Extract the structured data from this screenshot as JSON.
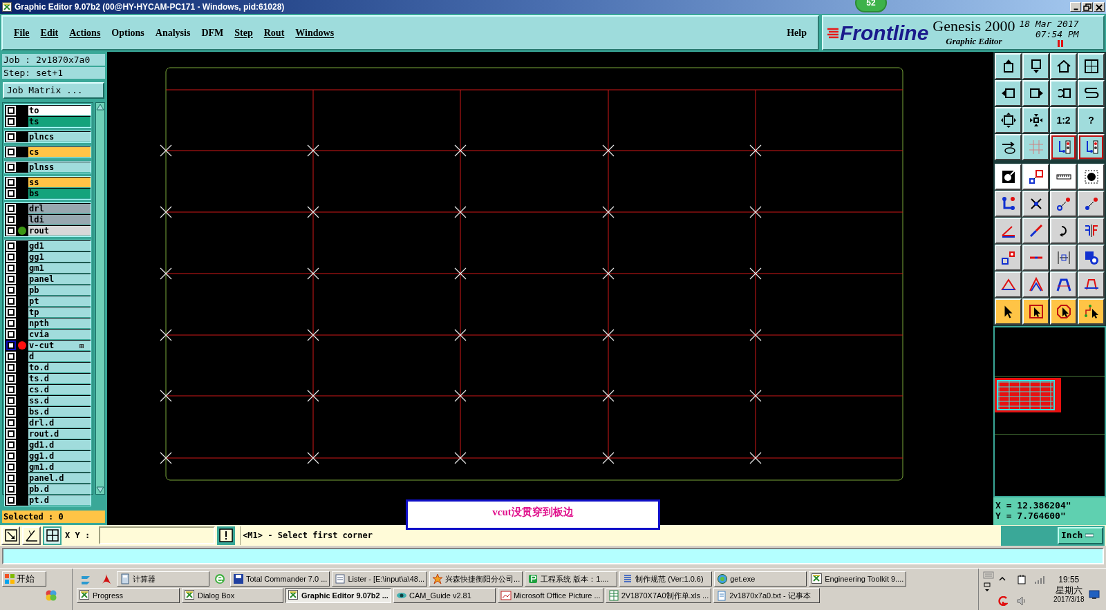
{
  "window": {
    "title": "Graphic Editor 9.07b2 (00@HY-HYCAM-PC171 - Windows, pid:61028)",
    "badge": "52"
  },
  "menu": [
    {
      "label": "File",
      "underline": true
    },
    {
      "label": "Edit",
      "underline": true
    },
    {
      "label": "Actions",
      "underline": true
    },
    {
      "label": "Options",
      "underline": false
    },
    {
      "label": "Analysis",
      "underline": false
    },
    {
      "label": "DFM",
      "underline": false
    },
    {
      "label": "Step",
      "underline": true
    },
    {
      "label": "Rout",
      "underline": true
    },
    {
      "label": "Windows",
      "underline": true
    }
  ],
  "help": "Help",
  "brand": {
    "logo": "Frontline",
    "product": "Genesis 2000",
    "subtitle": "Graphic Editor",
    "date": "18 Mar 2017",
    "time": "07:54 PM"
  },
  "job": "Job : 2v1870x7a0",
  "step": "Step: set+1",
  "job_matrix": "Job Matrix ...",
  "layer_groups": [
    [
      {
        "name": "to",
        "color": "#ffffff",
        "work_layer": false
      },
      {
        "name": "ts",
        "color": "#14a37c",
        "work_layer": false
      }
    ],
    [
      {
        "name": "plncs",
        "color": "#a0dcdc",
        "work_layer": false
      }
    ],
    [
      {
        "name": "cs",
        "color": "#ffc446",
        "work_layer": false
      }
    ],
    [
      {
        "name": "plnss",
        "color": "#a0dcdc",
        "work_layer": false
      }
    ],
    [
      {
        "name": "ss",
        "color": "#ffc446",
        "work_layer": false
      },
      {
        "name": "bs",
        "color": "#14a37c",
        "work_layer": false
      }
    ],
    [
      {
        "name": "drl",
        "color": "#98a8b0",
        "work_layer": false
      },
      {
        "name": "ldi",
        "color": "#98a8b0",
        "work_layer": false
      },
      {
        "name": "rout",
        "color": "#d8d8d8",
        "dot": {
          "color": "#3c9614"
        },
        "work_layer": false
      }
    ],
    [
      {
        "name": "gd1",
        "color": "#a0dcdc",
        "work_layer": false
      },
      {
        "name": "gg1",
        "color": "#a0dcdc",
        "work_layer": false
      },
      {
        "name": "gm1",
        "color": "#a0dcdc",
        "work_layer": false
      },
      {
        "name": "panel",
        "color": "#a0dcdc",
        "work_layer": false
      },
      {
        "name": "pb",
        "color": "#a0dcdc",
        "work_layer": false
      },
      {
        "name": "pt",
        "color": "#a0dcdc",
        "work_layer": false
      },
      {
        "name": "tp",
        "color": "#a0dcdc",
        "work_layer": false
      },
      {
        "name": "npth",
        "color": "#a0dcdc",
        "work_layer": false
      },
      {
        "name": "cvia",
        "color": "#a0dcdc",
        "work_layer": false
      },
      {
        "name": "v-cut",
        "color": "#a0dcdc",
        "dot": {
          "color": "#ff1010"
        },
        "work_layer": true
      },
      {
        "name": "d",
        "color": "#a0dcdc",
        "work_layer": false
      },
      {
        "name": "to.d",
        "color": "#a0dcdc",
        "work_layer": false
      },
      {
        "name": "ts.d",
        "color": "#a0dcdc",
        "work_layer": false
      },
      {
        "name": "cs.d",
        "color": "#a0dcdc",
        "work_layer": false
      },
      {
        "name": "ss.d",
        "color": "#a0dcdc",
        "work_layer": false
      },
      {
        "name": "bs.d",
        "color": "#a0dcdc",
        "work_layer": false
      },
      {
        "name": "drl.d",
        "color": "#a0dcdc",
        "work_layer": false
      },
      {
        "name": "rout.d",
        "color": "#a0dcdc",
        "work_layer": false
      },
      {
        "name": "gd1.d",
        "color": "#a0dcdc",
        "work_layer": false
      },
      {
        "name": "gg1.d",
        "color": "#a0dcdc",
        "work_layer": false
      },
      {
        "name": "gm1.d",
        "color": "#a0dcdc",
        "work_layer": false
      },
      {
        "name": "panel.d",
        "color": "#a0dcdc",
        "work_layer": false
      },
      {
        "name": "pb.d",
        "color": "#a0dcdc",
        "work_layer": false
      },
      {
        "name": "pt.d",
        "color": "#a0dcdc",
        "work_layer": false
      }
    ]
  ],
  "selected_count": "Selected : 0",
  "note": "vcut没贯穿到板边",
  "toolbar_texts": [
    "1:2",
    "?"
  ],
  "coords": {
    "x": "X = 12.386204\"",
    "y": "Y = 7.764600\""
  },
  "command": {
    "xy_label": "X Y :",
    "prompt": "<M1> - Select first corner",
    "units": "Inch"
  },
  "taskbar": {
    "start": "开始",
    "row_1": [
      {
        "label": "计算器",
        "selected": false
      },
      {
        "label": "Total Commander 7.0 ...",
        "selected": false
      },
      {
        "label": "Lister - [E:\\input\\a\\48...",
        "selected": false
      },
      {
        "label": "兴森快捷衡阳分公司...",
        "selected": false
      },
      {
        "label": "工程系统  版本：1....",
        "selected": false
      },
      {
        "label": "制作规范 (Ver:1.0.6)",
        "selected": false
      },
      {
        "label": "get.exe",
        "selected": false
      },
      {
        "label": "Engineering Toolkit 9....",
        "selected": false
      }
    ],
    "row_2": [
      {
        "label": "Progress",
        "selected": false
      },
      {
        "label": "Dialog Box",
        "selected": false
      },
      {
        "label": "Graphic Editor 9.07b2 ...",
        "selected": true
      },
      {
        "label": "CAM_Guide v2.81",
        "selected": false
      },
      {
        "label": "Microsoft Office Picture ...",
        "selected": false
      },
      {
        "label": "2V1870X7A0制作单.xls ...",
        "selected": false
      },
      {
        "label": "2v1870x7a0.txt - 记事本",
        "selected": false
      }
    ],
    "clock": "19:55",
    "weekday": "星期六",
    "date": "2017/3/18"
  }
}
